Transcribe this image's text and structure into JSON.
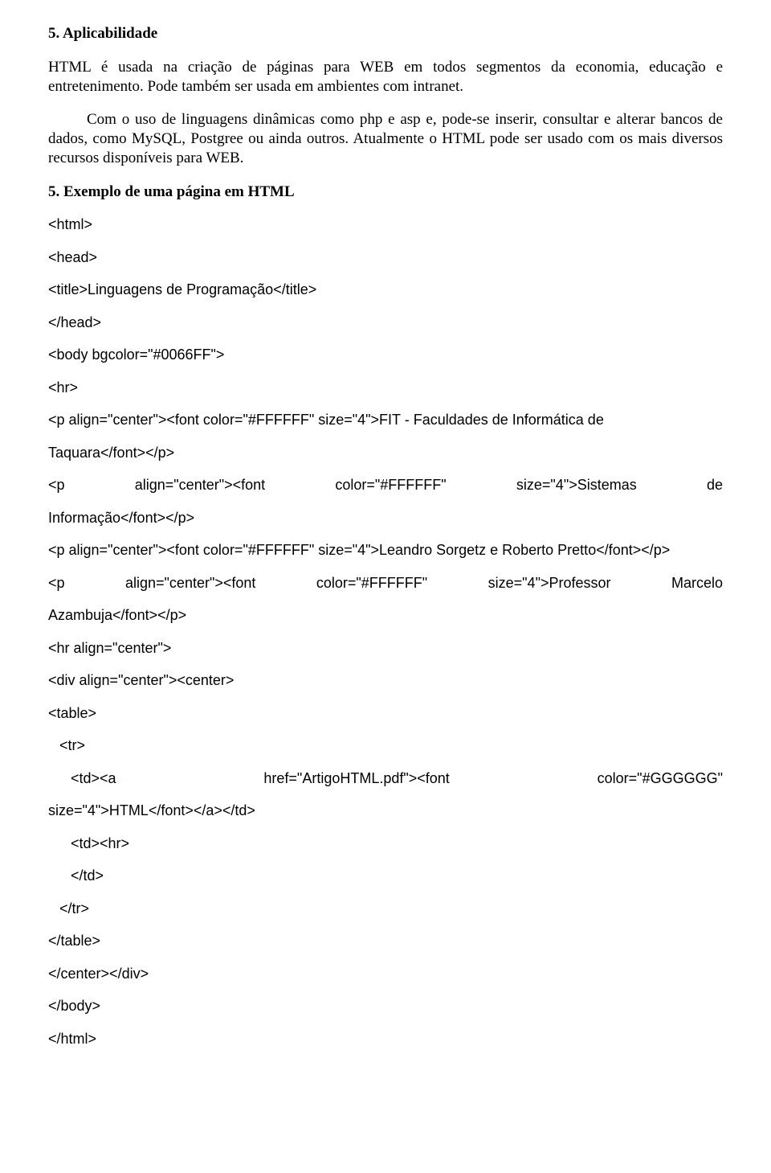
{
  "heading1": "5. Aplicabilidade",
  "para1": "HTML é usada na criação de páginas para WEB em todos segmentos da economia, educação e entretenimento. Pode também ser usada em ambientes com intranet.",
  "para2": "Com o uso de linguagens dinâmicas como php e  asp  e, pode-se inserir, consultar e alterar bancos de dados, como MySQL, Postgree ou ainda outros. Atualmente o HTML pode ser usado com os mais diversos recursos disponíveis para WEB.",
  "heading2": "5. Exemplo de uma página em HTML",
  "code": {
    "l1": "<html>",
    "l2": "<head>",
    "l3": "<title>Linguagens de Programação</title>",
    "l4": "</head>",
    "l5": "<body bgcolor=\"#0066FF\">",
    "l6": "<hr>",
    "l7a": "<p align=\"center\"><font color=\"#FFFFFF\" size=\"4\">FIT - Faculdades de Informática de",
    "l7b": "Taquara</font></p>",
    "l8_s0": "<p",
    "l8_s1": "align=\"center\"><font",
    "l8_s2": "color=\"#FFFFFF\"",
    "l8_s3": "size=\"4\">Sistemas",
    "l8_s4": "de",
    "l8b": "Informação</font></p>",
    "l9": "<p align=\"center\"><font color=\"#FFFFFF\" size=\"4\">Leandro Sorgetz e Roberto Pretto</font></p>",
    "l10_s0": "<p",
    "l10_s1": "align=\"center\"><font",
    "l10_s2": "color=\"#FFFFFF\"",
    "l10_s3": "size=\"4\">Professor",
    "l10_s4": "Marcelo",
    "l10b": "Azambuja</font></p>",
    "l11": "<hr align=\"center\">",
    "l12": "<div align=\"center\"><center>",
    "l13": "<table>",
    "l14": "<tr>",
    "l15_s0": "<td><a",
    "l15_s1": "href=\"ArtigoHTML.pdf\"><font",
    "l15_s2": "color=\"#GGGGGG\"",
    "l15b": "size=\"4\">HTML</font></a></td>",
    "l16": "<td><hr>",
    "l17": "</td>",
    "l18": "</tr>",
    "l19": "</table>",
    "l20": "</center></div>",
    "l21": "</body>",
    "l22": "</html>"
  }
}
